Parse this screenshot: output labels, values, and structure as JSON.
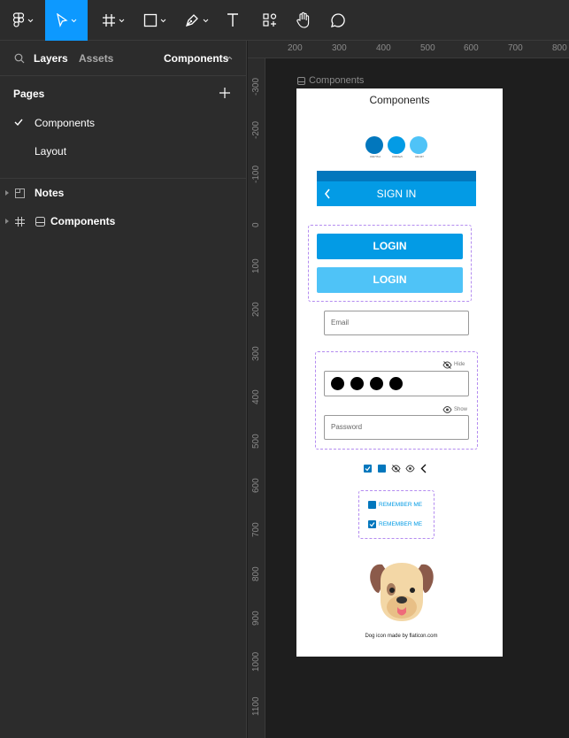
{
  "toolbar": {
    "tools": [
      "figma-menu",
      "move",
      "frame",
      "shape",
      "pen",
      "text",
      "resources",
      "hand",
      "comment"
    ]
  },
  "sidebar": {
    "tab_layers": "Layers",
    "tab_assets": "Assets",
    "page_selector": "Components",
    "pages_title": "Pages",
    "pages": [
      {
        "label": "Components",
        "selected": true
      },
      {
        "label": "Layout",
        "selected": false
      }
    ],
    "layers": [
      {
        "label": "Notes"
      },
      {
        "label": "Components"
      }
    ]
  },
  "rulers": {
    "top": [
      "200",
      "300",
      "400",
      "500",
      "600",
      "700",
      "800"
    ],
    "left": [
      "-300",
      "-200",
      "-100",
      "0",
      "100",
      "200",
      "300",
      "400",
      "500",
      "600",
      "700",
      "800",
      "900",
      "1000",
      "1100"
    ]
  },
  "canvas": {
    "frame_label": "Components",
    "title": "Components",
    "swatches": [
      {
        "color": "#0277bd",
        "label": "#0277bd"
      },
      {
        "color": "#039be5",
        "label": "#039be5"
      },
      {
        "color": "#4fc3f7",
        "label": "#4fc3f7"
      }
    ],
    "app_bar_title": "SIGN IN",
    "login_primary": "LOGIN",
    "login_secondary": "LOGIN",
    "email_placeholder": "Email",
    "hide_label": "Hide",
    "show_label": "Show",
    "password_placeholder": "Password",
    "remember_unchecked": "REMEMBER ME",
    "remember_checked": "REMEMBER ME",
    "credit": "Dog icon made by flaticon.com"
  },
  "colors": {
    "primary_dark": "#0277bd",
    "primary": "#039be5",
    "primary_light": "#4fc3f7",
    "accent_figma": "#0d99ff"
  }
}
